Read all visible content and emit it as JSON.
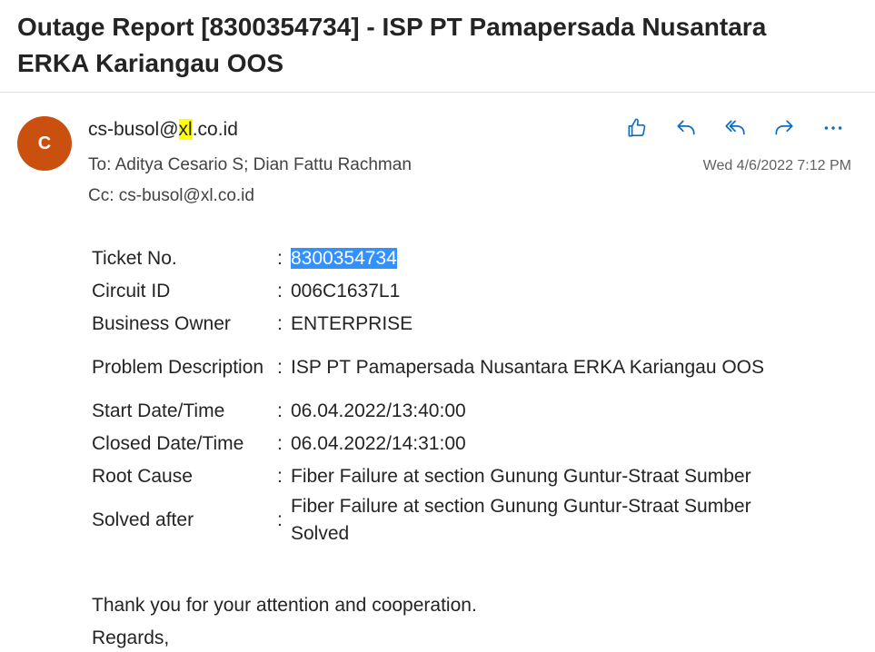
{
  "subject": "Outage Report [8300354734] - ISP PT Pamapersada Nusantara ERKA Kariangau OOS",
  "avatar_initial": "C",
  "sender": {
    "prefix": "cs-busol@",
    "highlight": "xl",
    "suffix": ".co.id"
  },
  "to_line": "To:  Aditya Cesario S;  Dian Fattu Rachman",
  "cc_line": "Cc:  cs-busol@xl.co.id",
  "date": "Wed 4/6/2022 7:12 PM",
  "actions": [
    {
      "name": "like-icon"
    },
    {
      "name": "reply-icon"
    },
    {
      "name": "reply-all-icon"
    },
    {
      "name": "forward-icon"
    },
    {
      "name": "more-icon"
    }
  ],
  "details": [
    {
      "label": "Ticket No.",
      "value": "8300354734"
    },
    {
      "label": "Circuit ID",
      "value": "006C1637L1"
    },
    {
      "label": "Business Owner",
      "value": "ENTERPRISE"
    },
    {
      "label": "Problem Description",
      "value": "ISP PT Pamapersada Nusantara ERKA Kariangau OOS"
    },
    {
      "label": "Start Date/Time",
      "value": "06.04.2022/13:40:00"
    },
    {
      "label": "Closed Date/Time",
      "value": "06.04.2022/14:31:00"
    },
    {
      "label": "Root Cause",
      "value": "Fiber Failure at section Gunung Guntur-Straat Sumber"
    },
    {
      "label": "Solved after",
      "value": "Fiber Failure at section Gunung Guntur-Straat Sumber Solved"
    }
  ],
  "colon": ":",
  "closing": "Thank you for your attention and cooperation.",
  "regards": "Regards,"
}
